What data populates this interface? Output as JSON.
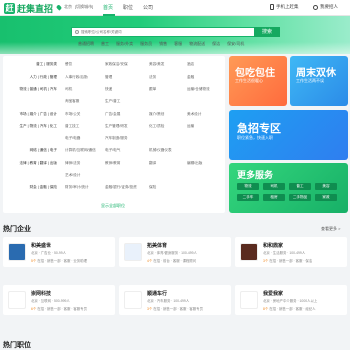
{
  "header": {
    "logo_mark": "赶",
    "logo_text": "赶集直招",
    "city": "北京",
    "city_switch": "[切换城市]",
    "nav": [
      "首页",
      "职位",
      "公司"
    ],
    "phone_label": "手机上赶集",
    "recruit_label": "我要招人"
  },
  "search": {
    "placeholder": "搜索职位/公司名称/关键词",
    "button": "搜索",
    "hot": [
      "普通招聘",
      "普工",
      "服务/外卖",
      "服务员",
      "销售",
      "客服",
      "物流配送",
      "保洁",
      "保安/司机"
    ]
  },
  "categories": [
    {
      "name": "普工 | 服务类",
      "subs": [
        "餐饮",
        "家政保洁/安保",
        "美容/美发",
        "酒店"
      ]
    },
    {
      "name": "人力 | 行政 | 管理",
      "subs": [
        "人事行政/后勤",
        "管理",
        "法务",
        "金融"
      ]
    },
    {
      "name": "物流 | 普通 | 司机 | 汽车",
      "subs": [
        "司机",
        "快递",
        "跟单",
        "运输/仓储物流"
      ]
    },
    {
      "name": "",
      "subs": [
        "淘宝客服",
        "生产/普工",
        "",
        ""
      ]
    },
    {
      "name": "市场 | 媒介 | 广告 | 设计",
      "subs": [
        "市场/公关",
        "广告/会展",
        "媒介/策划",
        "美术设计"
      ]
    },
    {
      "name": "生产 | 物流 | 汽车 | 化工",
      "subs": [
        "普工技工",
        "生产管理/研发",
        "化工/质检",
        "运输"
      ]
    },
    {
      "name": "",
      "subs": [
        "电子/电器",
        "汽车制造/服务",
        "",
        ""
      ]
    },
    {
      "name": "网络 | 通信 | 电子",
      "subs": [
        "计算机/互联网/通信",
        "电子/电气",
        "机械/仪器仪表",
        ""
      ]
    },
    {
      "name": "法律 | 教育 | 翻译 | 出版",
      "subs": [
        "律师/法务",
        "教师/教育",
        "翻译",
        "编辑/出版"
      ]
    },
    {
      "name": "",
      "subs": [
        "艺术/设计",
        "",
        "",
        ""
      ]
    },
    {
      "name": "财会 | 金融 | 保险",
      "subs": [
        "财务/审计/统计",
        "金融/银行/证券/投资",
        "保险",
        ""
      ]
    }
  ],
  "categories_more": "显示全部职位",
  "banners": {
    "b1": {
      "title": "包吃包住",
      "sub": "工作生活很暖心"
    },
    "b2": {
      "title": "周末双休",
      "sub": "工作生活两不误"
    },
    "b3": {
      "title": "急招专区",
      "sub": "职位紧急，快速入职"
    },
    "b4": {
      "title": "更多服务",
      "tags": [
        "物流",
        "司机",
        "普工",
        "美容",
        "二手车",
        "租房",
        "二手物品",
        "家政"
      ]
    }
  },
  "hot_companies": {
    "title": "热门企业",
    "more": "查看更多 >",
    "items": [
      {
        "name": "和美盛世",
        "info": "北京 · 广告业 · 50-99人",
        "jobs_count": "5个",
        "jobs_text": "在招 · 销售一部 · 客服 · 业务助理"
      },
      {
        "name": "拓美体育",
        "info": "北京 · 体育/健身服务 · 100-499人",
        "jobs_count": "4个",
        "jobs_text": "在招 · 前台 · 客服 · 课程顾问"
      },
      {
        "name": "和和鼎家",
        "info": "北京 · 生活服务 · 100-499人",
        "jobs_count": "3个",
        "jobs_text": "在招 · 销售一部 · 客服 · 保洁"
      },
      {
        "name": "崇网科技",
        "info": "北京 · 互联网 · 500-999人",
        "jobs_count": "6个",
        "jobs_text": "在招 · 销售一部 · 客服 · 客服专员"
      },
      {
        "name": "顺通车行",
        "info": "北京 · 汽车服务 · 100-499人",
        "jobs_count": "3个",
        "jobs_text": "在招 · 销售一部 · 客服 · 客服专员"
      },
      {
        "name": "我爱我家",
        "info": "北京 · 房地产中介服务 · 1000人以上",
        "jobs_count": "8个",
        "jobs_text": "在招 · 销售一部 · 客服 · 经纪人"
      }
    ]
  },
  "hot_jobs": {
    "title": "热门职位"
  },
  "colors": {
    "brand": "#18b26b",
    "accent_orange": "#f08a24"
  }
}
